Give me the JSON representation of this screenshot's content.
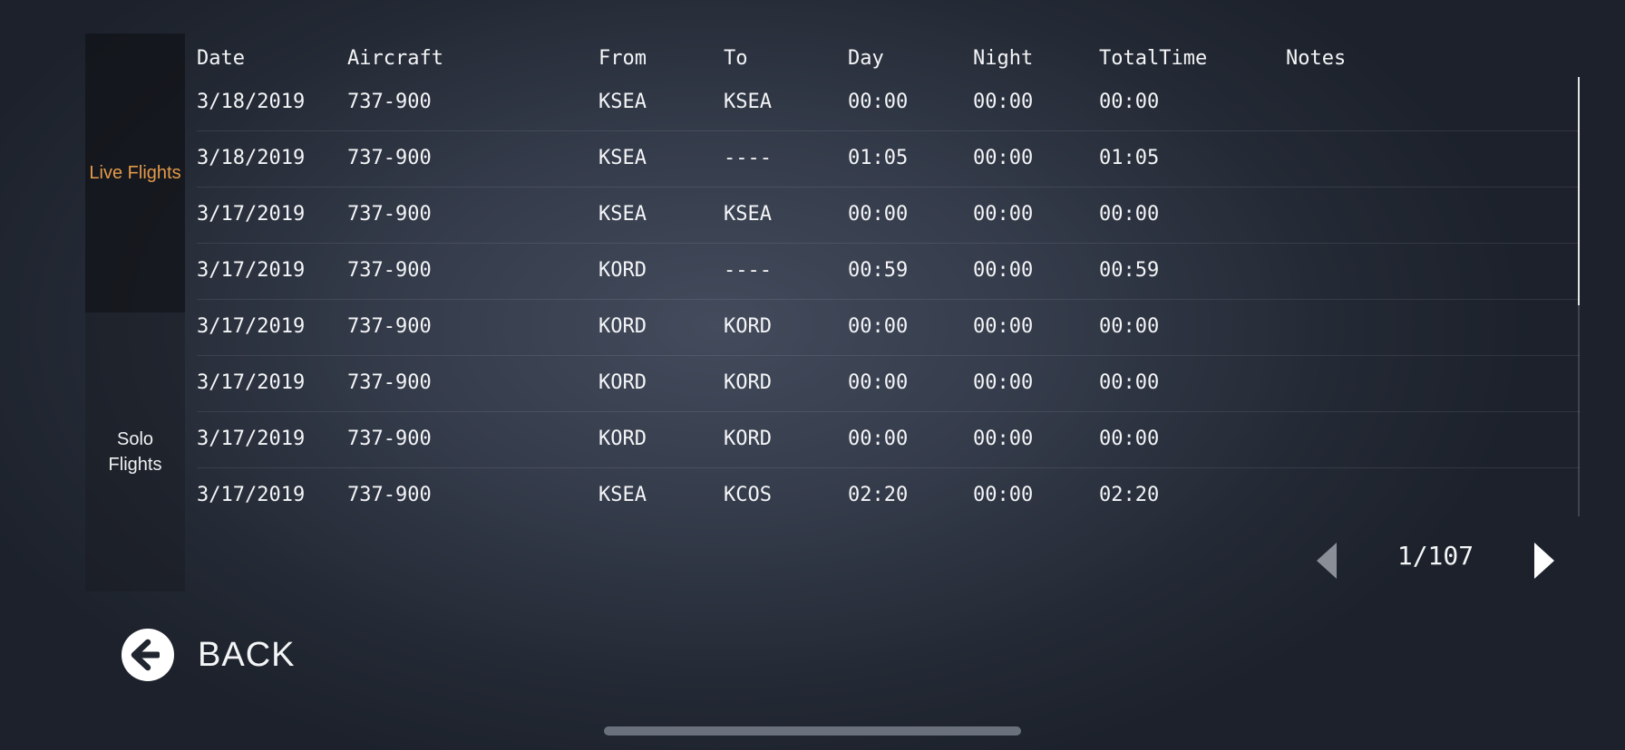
{
  "sidebar": {
    "tabs": [
      {
        "label": "Live Flights",
        "active": true
      },
      {
        "label": "Solo Flights",
        "active": false
      }
    ],
    "active_color": "#e59a4a"
  },
  "table": {
    "columns": [
      "Date",
      "Aircraft",
      "From",
      "To",
      "Day",
      "Night",
      "TotalTime",
      "Notes"
    ],
    "rows": [
      {
        "date": "3/18/2019",
        "aircraft": "737-900",
        "from": "KSEA",
        "to": "KSEA",
        "day": "00:00",
        "night": "00:00",
        "total": "00:00",
        "notes": ""
      },
      {
        "date": "3/18/2019",
        "aircraft": "737-900",
        "from": "KSEA",
        "to": "----",
        "day": "01:05",
        "night": "00:00",
        "total": "01:05",
        "notes": ""
      },
      {
        "date": "3/17/2019",
        "aircraft": "737-900",
        "from": "KSEA",
        "to": "KSEA",
        "day": "00:00",
        "night": "00:00",
        "total": "00:00",
        "notes": ""
      },
      {
        "date": "3/17/2019",
        "aircraft": "737-900",
        "from": "KORD",
        "to": "----",
        "day": "00:59",
        "night": "00:00",
        "total": "00:59",
        "notes": ""
      },
      {
        "date": "3/17/2019",
        "aircraft": "737-900",
        "from": "KORD",
        "to": "KORD",
        "day": "00:00",
        "night": "00:00",
        "total": "00:00",
        "notes": ""
      },
      {
        "date": "3/17/2019",
        "aircraft": "737-900",
        "from": "KORD",
        "to": "KORD",
        "day": "00:00",
        "night": "00:00",
        "total": "00:00",
        "notes": ""
      },
      {
        "date": "3/17/2019",
        "aircraft": "737-900",
        "from": "KORD",
        "to": "KORD",
        "day": "00:00",
        "night": "00:00",
        "total": "00:00",
        "notes": ""
      },
      {
        "date": "3/17/2019",
        "aircraft": "737-900",
        "from": "KSEA",
        "to": "KCOS",
        "day": "02:20",
        "night": "00:00",
        "total": "02:20",
        "notes": ""
      }
    ]
  },
  "pagination": {
    "indicator": "1/107",
    "prev_icon": "caret-left-icon",
    "next_icon": "caret-right-icon",
    "prev_enabled": false,
    "next_enabled": true
  },
  "back": {
    "label": "BACK",
    "icon": "arrow-left-circle-icon"
  }
}
